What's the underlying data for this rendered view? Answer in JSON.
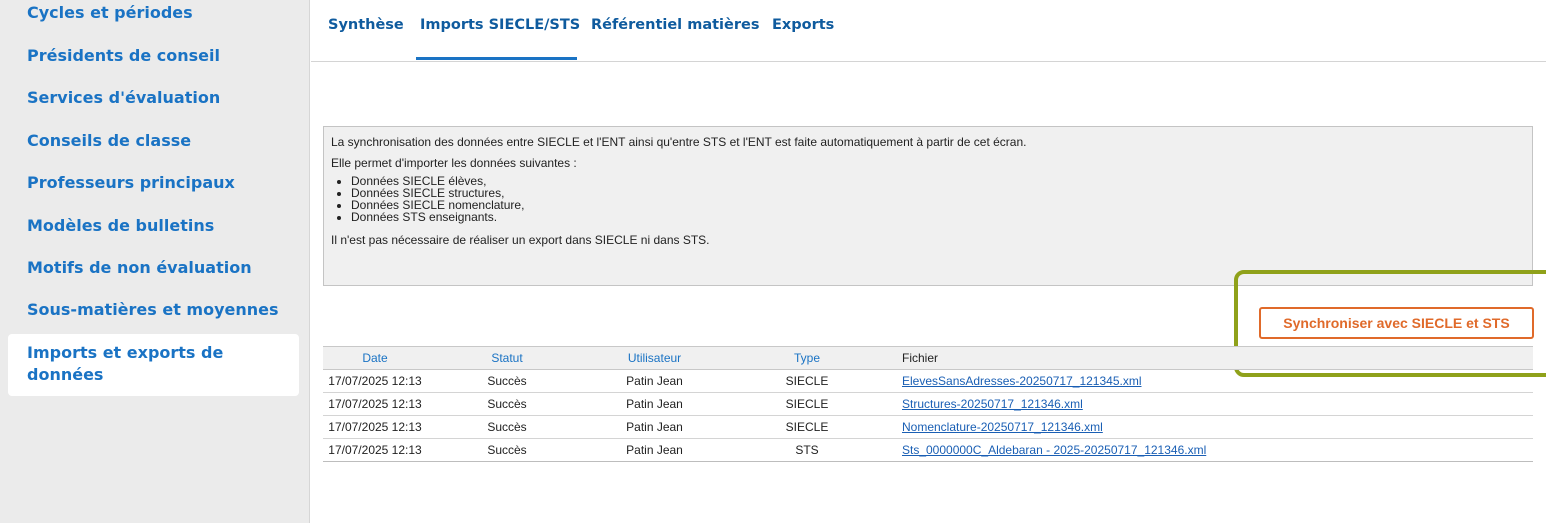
{
  "sidebar": {
    "items": [
      {
        "label": "Cycles et périodes"
      },
      {
        "label": "Présidents de conseil"
      },
      {
        "label": "Services d'évaluation"
      },
      {
        "label": "Conseils de classe"
      },
      {
        "label": "Professeurs principaux"
      },
      {
        "label": "Modèles de bulletins"
      },
      {
        "label": "Motifs de non évaluation"
      },
      {
        "label": "Sous-matières et moyennes"
      },
      {
        "label": "Imports et exports de données",
        "active": true
      }
    ]
  },
  "tabs": [
    {
      "label": "Synthèse"
    },
    {
      "label": "Imports SIECLE/STS",
      "active": true
    },
    {
      "label": "Référentiel matières"
    },
    {
      "label": "Exports"
    }
  ],
  "info": {
    "line1": "La synchronisation des données entre SIECLE et l'ENT ainsi qu'entre STS et l'ENT est faite automatiquement à partir de cet écran.",
    "line2": "Elle permet d'importer les données suivantes :",
    "bullets": [
      "Données SIECLE élèves,",
      "Données SIECLE structures,",
      "Données SIECLE nomenclature,",
      "Données STS enseignants."
    ],
    "line3": "Il n'est pas nécessaire de réaliser un export dans SIECLE ni dans STS."
  },
  "sync_button": {
    "label": "Synchroniser avec SIECLE et STS"
  },
  "table": {
    "headers": [
      "Date",
      "Statut",
      "Utilisateur",
      "Type",
      "Fichier"
    ],
    "rows": [
      {
        "date": "17/07/2025 12:13",
        "statut": "Succès",
        "utilisateur": "Patin Jean",
        "type": "SIECLE",
        "fichier": "ElevesSansAdresses-20250717_121345.xml"
      },
      {
        "date": "17/07/2025 12:13",
        "statut": "Succès",
        "utilisateur": "Patin Jean",
        "type": "SIECLE",
        "fichier": "Structures-20250717_121346.xml"
      },
      {
        "date": "17/07/2025 12:13",
        "statut": "Succès",
        "utilisateur": "Patin Jean",
        "type": "SIECLE",
        "fichier": "Nomenclature-20250717_121346.xml"
      },
      {
        "date": "17/07/2025 12:13",
        "statut": "Succès",
        "utilisateur": "Patin Jean",
        "type": "STS",
        "fichier": "Sts_0000000C_Aldebaran - 2025-20250717_121346.xml"
      }
    ]
  },
  "colors": {
    "link_blue": "#1a73c4",
    "accent_orange": "#e06a2a",
    "highlight_olive": "#8fa11a"
  }
}
